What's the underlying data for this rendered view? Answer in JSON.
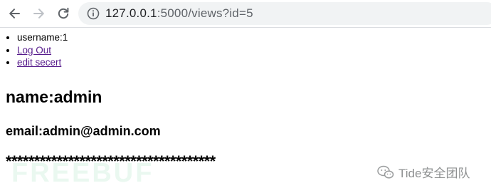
{
  "browser": {
    "url_host": "127.0.0.1",
    "url_rest": ":5000/views?id=5"
  },
  "page": {
    "menu": {
      "username": "username:1",
      "logout": "Log Out",
      "edit_secret": "edit secert"
    },
    "name": "name:admin",
    "email": "email:admin@admin.com",
    "secret": "*************************************"
  },
  "watermarks": {
    "freebuf": "FREEBUF",
    "tide": "Tide安全团队"
  },
  "colors": {
    "link_visited": "#551a8b",
    "omnibox_bg": "#f1f3f4"
  },
  "icons": [
    "back-arrow-icon",
    "forward-arrow-icon",
    "reload-icon",
    "info-icon",
    "wechat-icon"
  ]
}
